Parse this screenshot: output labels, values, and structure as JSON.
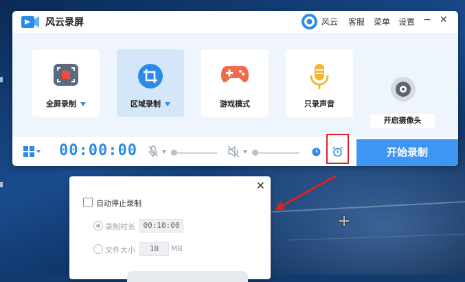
{
  "window": {
    "title": "风云录屏",
    "brand_label": "风云",
    "menu": {
      "service": "客服",
      "menu": "菜单",
      "settings": "设置"
    },
    "minimize": "−",
    "close": "✕"
  },
  "modes": [
    {
      "label": "全屏录制",
      "icon": "fullscreen-record-icon",
      "has_dropdown": true,
      "active": false
    },
    {
      "label": "区域录制",
      "icon": "crop-region-icon",
      "has_dropdown": true,
      "active": true
    },
    {
      "label": "游戏模式",
      "icon": "gamepad-icon",
      "has_dropdown": false,
      "active": false
    },
    {
      "label": "只录声音",
      "icon": "microphone-icon",
      "has_dropdown": false,
      "active": false
    },
    {
      "label": "开启摄像头",
      "icon": "camera-icon",
      "has_dropdown": false,
      "active": false
    }
  ],
  "controls": {
    "timer": "00:00:00",
    "start_button": "开始录制",
    "mic_icon": "microphone-muted-icon",
    "speaker_icon": "speaker-muted-icon",
    "clock_icon": "clock-icon",
    "alarm_icon": "alarm-clock-icon",
    "layout_icon": "grid-layout-icon"
  },
  "popup": {
    "close": "✕",
    "auto_stop_label": "自动停止录制",
    "auto_stop_checked": false,
    "duration_label": "录制时长",
    "duration_value": "00:10:00",
    "filesize_label": "文件大小",
    "filesize_value": "10",
    "filesize_unit": "MB"
  },
  "colors": {
    "accent": "#2d8ae8",
    "start_button": "#3f95f2",
    "highlight": "#e02020",
    "active_card": "#d4e6f9"
  }
}
